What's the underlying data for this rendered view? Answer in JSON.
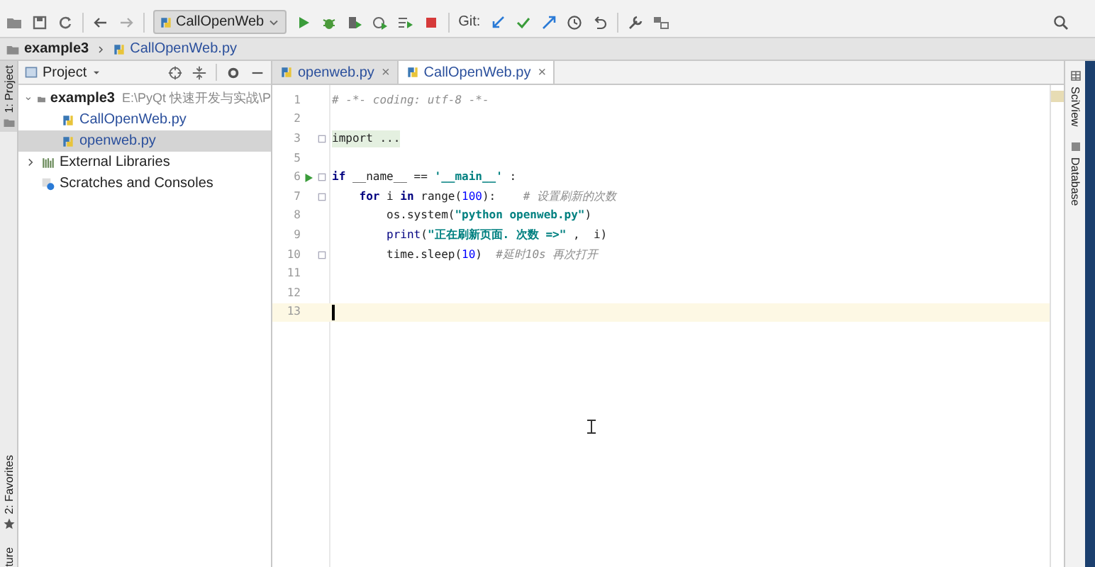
{
  "toolbar": {
    "run_config": "CallOpenWeb",
    "git_label": "Git:"
  },
  "breadcrumb": [
    "example3",
    "CallOpenWeb.py"
  ],
  "left_strip": {
    "top": "1: Project",
    "favorites": "2: Favorites",
    "bottom": "ture"
  },
  "project_panel": {
    "title": "Project",
    "tree": [
      {
        "label": "example3",
        "path": "E:\\PyQt 快速开发与实战\\P",
        "kind": "folder",
        "expanded": true,
        "selected": false,
        "children": [
          {
            "label": "CallOpenWeb.py",
            "kind": "python",
            "selected": false
          },
          {
            "label": "openweb.py",
            "kind": "python",
            "selected": true
          }
        ]
      },
      {
        "label": "External Libraries",
        "kind": "library",
        "expanded": false,
        "selected": false
      },
      {
        "label": "Scratches and Consoles",
        "kind": "scratch",
        "selected": false
      }
    ]
  },
  "tabs": [
    {
      "label": "openweb.py",
      "close": "×",
      "selected": false
    },
    {
      "label": "CallOpenWeb.py",
      "close": "×",
      "selected": true
    }
  ],
  "editor": {
    "lines": [
      {
        "number": "1",
        "tokens": [
          {
            "kind": "comment",
            "text": "# -*- coding: utf-8 -*-"
          }
        ]
      },
      {
        "number": "2"
      },
      {
        "number": "3",
        "fold": true,
        "tokens": [
          {
            "kind": "folded",
            "text": "import ..."
          }
        ]
      },
      {
        "number": "5"
      },
      {
        "number": "6",
        "run": true,
        "fold": true,
        "tokens": [
          {
            "kind": "keyword",
            "text": "if "
          },
          {
            "kind": "plain",
            "text": "__name__ == "
          },
          {
            "kind": "string",
            "text": "'__main__'"
          },
          {
            "kind": "plain",
            "text": " :"
          }
        ]
      },
      {
        "number": "7",
        "fold": true,
        "tokens": [
          {
            "kind": "keyword",
            "text": "    for "
          },
          {
            "kind": "plain",
            "text": "i "
          },
          {
            "kind": "keyword",
            "text": "in "
          },
          {
            "kind": "plain",
            "text": "range("
          },
          {
            "kind": "number",
            "text": "100"
          },
          {
            "kind": "plain",
            "text": "):    "
          },
          {
            "kind": "comment",
            "text": "# 设置刷新的次数"
          }
        ]
      },
      {
        "number": "8",
        "tokens": [
          {
            "kind": "plain",
            "text": "        os.system("
          },
          {
            "kind": "string",
            "text": "\"python openweb.py\""
          },
          {
            "kind": "plain",
            "text": ")"
          }
        ]
      },
      {
        "number": "9",
        "tokens": [
          {
            "kind": "builtin",
            "text": "        print"
          },
          {
            "kind": "plain",
            "text": "("
          },
          {
            "kind": "string",
            "text": "\"正在刷新页面. 次数 =>\""
          },
          {
            "kind": "plain",
            "text": " ,  i)"
          }
        ]
      },
      {
        "number": "10",
        "fold": true,
        "tokens": [
          {
            "kind": "plain",
            "text": "        time.sleep("
          },
          {
            "kind": "number",
            "text": "10"
          },
          {
            "kind": "plain",
            "text": ")  "
          },
          {
            "kind": "comment",
            "text": "#延时10s 再次打开"
          }
        ]
      },
      {
        "number": "11"
      },
      {
        "number": "12"
      },
      {
        "number": "13",
        "current": true
      }
    ]
  },
  "right_strip": [
    "SciView",
    "Database"
  ]
}
